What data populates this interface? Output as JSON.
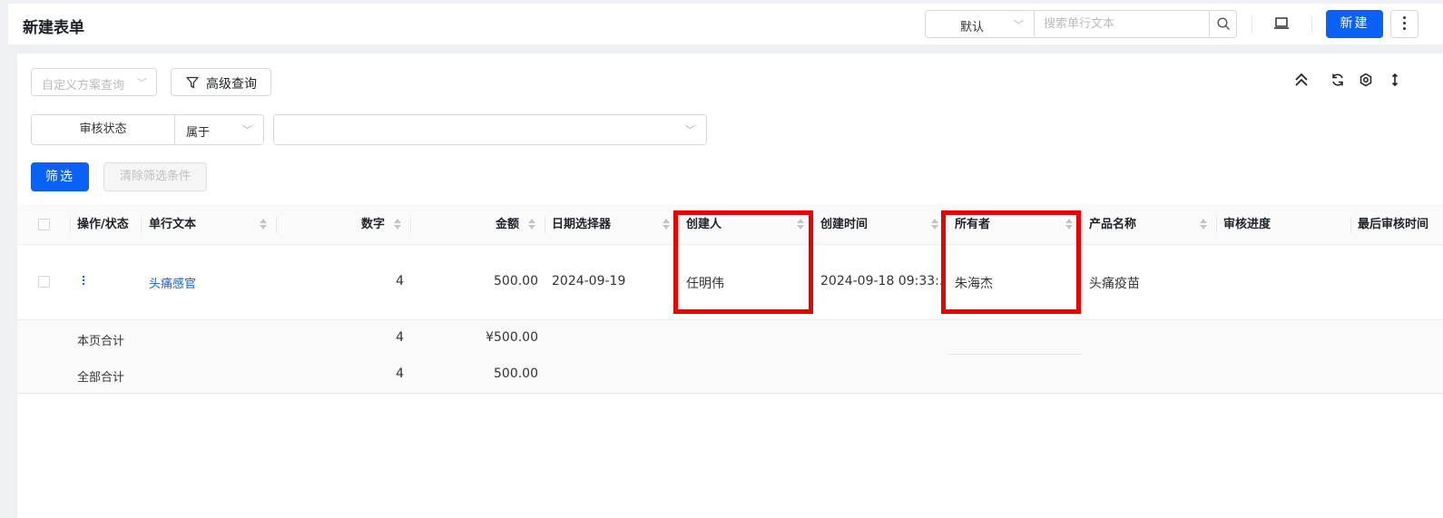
{
  "header": {
    "title": "新建表单",
    "view_select": "默认",
    "search_placeholder": "搜索单行文本",
    "new_button": "新建"
  },
  "toolbar": {
    "preset_query_placeholder": "自定义方案查询",
    "advanced_query": "高级查询"
  },
  "filter": {
    "field": "审核状态",
    "operator": "属于",
    "value": "",
    "filter_button": "筛选",
    "clear_button": "清除筛选条件"
  },
  "table": {
    "columns": [
      "操作/状态",
      "单行文本",
      "数字",
      "金额",
      "日期选择器",
      "创建人",
      "创建时间",
      "所有者",
      "产品名称",
      "审核进度",
      "最后审核时间"
    ],
    "rows": [
      {
        "text": "头痛感官",
        "number": "4",
        "amount": "500.00",
        "date": "2024-09-19",
        "creator": "任明伟",
        "created_time": "2024-09-18 09:33:...",
        "owner": "朱海杰",
        "product": "头痛疫苗"
      }
    ],
    "summary": [
      {
        "label": "本页合计",
        "number": "4",
        "amount": "¥500.00"
      },
      {
        "label": "全部合计",
        "number": "4",
        "amount": "500.00"
      }
    ]
  },
  "colors": {
    "primary": "#0a61f5",
    "highlight": "#ee0000"
  }
}
